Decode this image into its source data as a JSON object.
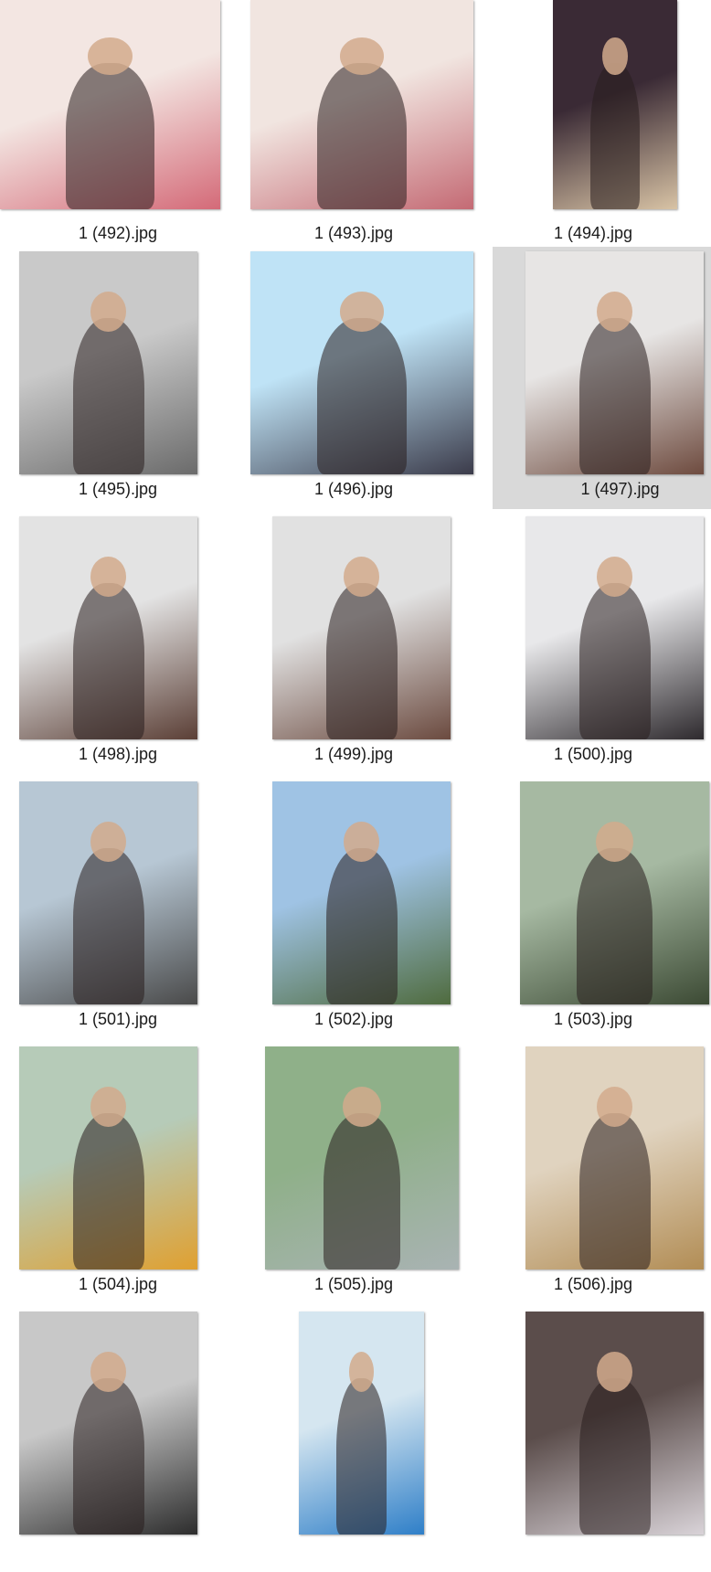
{
  "items": [
    {
      "label": "1 (492).jpg",
      "icon": "photo-thumbnail-icon",
      "colors": [
        "#f3e6e2",
        "#d46a78"
      ],
      "selected": false
    },
    {
      "label": "1 (493).jpg",
      "icon": "photo-thumbnail-icon",
      "colors": [
        "#f1e5e0",
        "#c46a74"
      ],
      "selected": false
    },
    {
      "label": "1 (494).jpg",
      "icon": "photo-thumbnail-icon",
      "colors": [
        "#3a2a35",
        "#d8c3a5"
      ],
      "selected": false
    },
    {
      "label": "1 (495).jpg",
      "icon": "photo-thumbnail-icon",
      "colors": [
        "#c9c9c9",
        "#6b6b6b"
      ],
      "selected": false
    },
    {
      "label": "1 (496).jpg",
      "icon": "photo-thumbnail-icon",
      "colors": [
        "#bfe3f6",
        "#3b3b4a"
      ],
      "selected": false
    },
    {
      "label": "1 (497).jpg",
      "icon": "photo-thumbnail-icon",
      "colors": [
        "#e7e5e4",
        "#6e4b3f"
      ],
      "selected": true
    },
    {
      "label": "1 (498).jpg",
      "icon": "photo-thumbnail-icon",
      "colors": [
        "#e3e3e3",
        "#5b3f36"
      ],
      "selected": false
    },
    {
      "label": "1 (499).jpg",
      "icon": "photo-thumbnail-icon",
      "colors": [
        "#e1e1e1",
        "#6b4a3f"
      ],
      "selected": false
    },
    {
      "label": "1 (500).jpg",
      "icon": "photo-thumbnail-icon",
      "colors": [
        "#e8e8ea",
        "#2e2a2e"
      ],
      "selected": false
    },
    {
      "label": "1 (501).jpg",
      "icon": "photo-thumbnail-icon",
      "colors": [
        "#b7c7d4",
        "#4a4a4a"
      ],
      "selected": false
    },
    {
      "label": "1 (502).jpg",
      "icon": "photo-thumbnail-icon",
      "colors": [
        "#9fc3e4",
        "#4f6b3e"
      ],
      "selected": false
    },
    {
      "label": "1 (503).jpg",
      "icon": "photo-thumbnail-icon",
      "colors": [
        "#a6b9a2",
        "#3c4a34"
      ],
      "selected": false
    },
    {
      "label": "1 (504).jpg",
      "icon": "photo-thumbnail-icon",
      "colors": [
        "#b6cbb8",
        "#e0a030"
      ],
      "selected": false
    },
    {
      "label": "1 (505).jpg",
      "icon": "photo-thumbnail-icon",
      "colors": [
        "#8fb089",
        "#a9b3b3"
      ],
      "selected": false
    },
    {
      "label": "1 (506).jpg",
      "icon": "photo-thumbnail-icon",
      "colors": [
        "#e0d3bf",
        "#b28d55"
      ],
      "selected": false
    },
    {
      "label": "",
      "icon": "photo-thumbnail-icon",
      "colors": [
        "#c8c8c8",
        "#2d2d2d"
      ],
      "selected": false
    },
    {
      "label": "",
      "icon": "photo-thumbnail-icon",
      "colors": [
        "#d5e6f0",
        "#2f7fc8"
      ],
      "selected": false
    },
    {
      "label": "",
      "icon": "photo-thumbnail-icon",
      "colors": [
        "#5b4d4b",
        "#d9d3d8"
      ],
      "selected": false
    }
  ]
}
